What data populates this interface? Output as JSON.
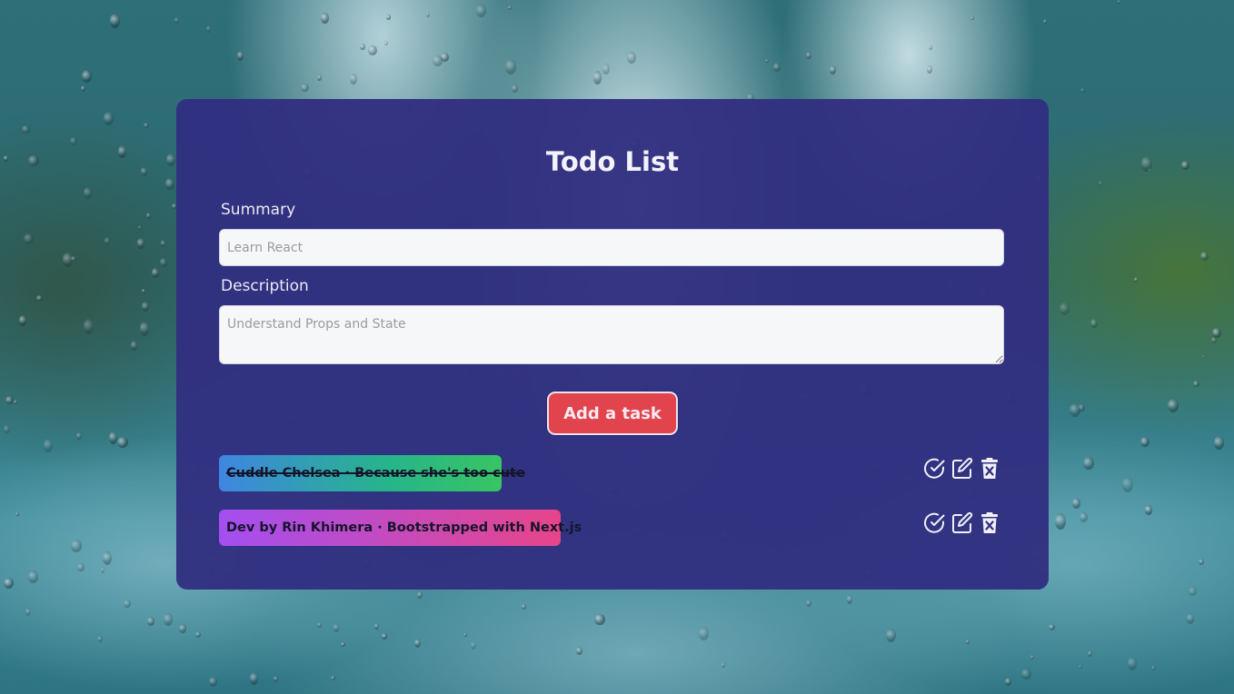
{
  "app": {
    "title": "Todo List"
  },
  "form": {
    "summary_label": "Summary",
    "summary_placeholder": "Learn React",
    "summary_value": "",
    "description_label": "Description",
    "description_placeholder": "Understand Props and State",
    "description_value": "",
    "add_button_label": "Add a task"
  },
  "tasks": [
    {
      "text": "Cuddle Chelsea · Because she's too cute",
      "completed": true,
      "colors": [
        "#3f86e0",
        "#26b58a",
        "#39c462"
      ],
      "actions": [
        "check-circle-icon",
        "edit-icon",
        "trash-icon"
      ]
    },
    {
      "text": "Dev by Rin Khimera · Bootstrapped with Next.js",
      "completed": false,
      "colors": [
        "#a34ff0",
        "#c84ab8",
        "#e7458a"
      ],
      "actions": [
        "check-circle-icon",
        "edit-icon",
        "trash-icon"
      ]
    }
  ],
  "theme": {
    "card_background": "#312f80",
    "button_color": "#e2444d",
    "text_color": "#f3f1fa"
  }
}
